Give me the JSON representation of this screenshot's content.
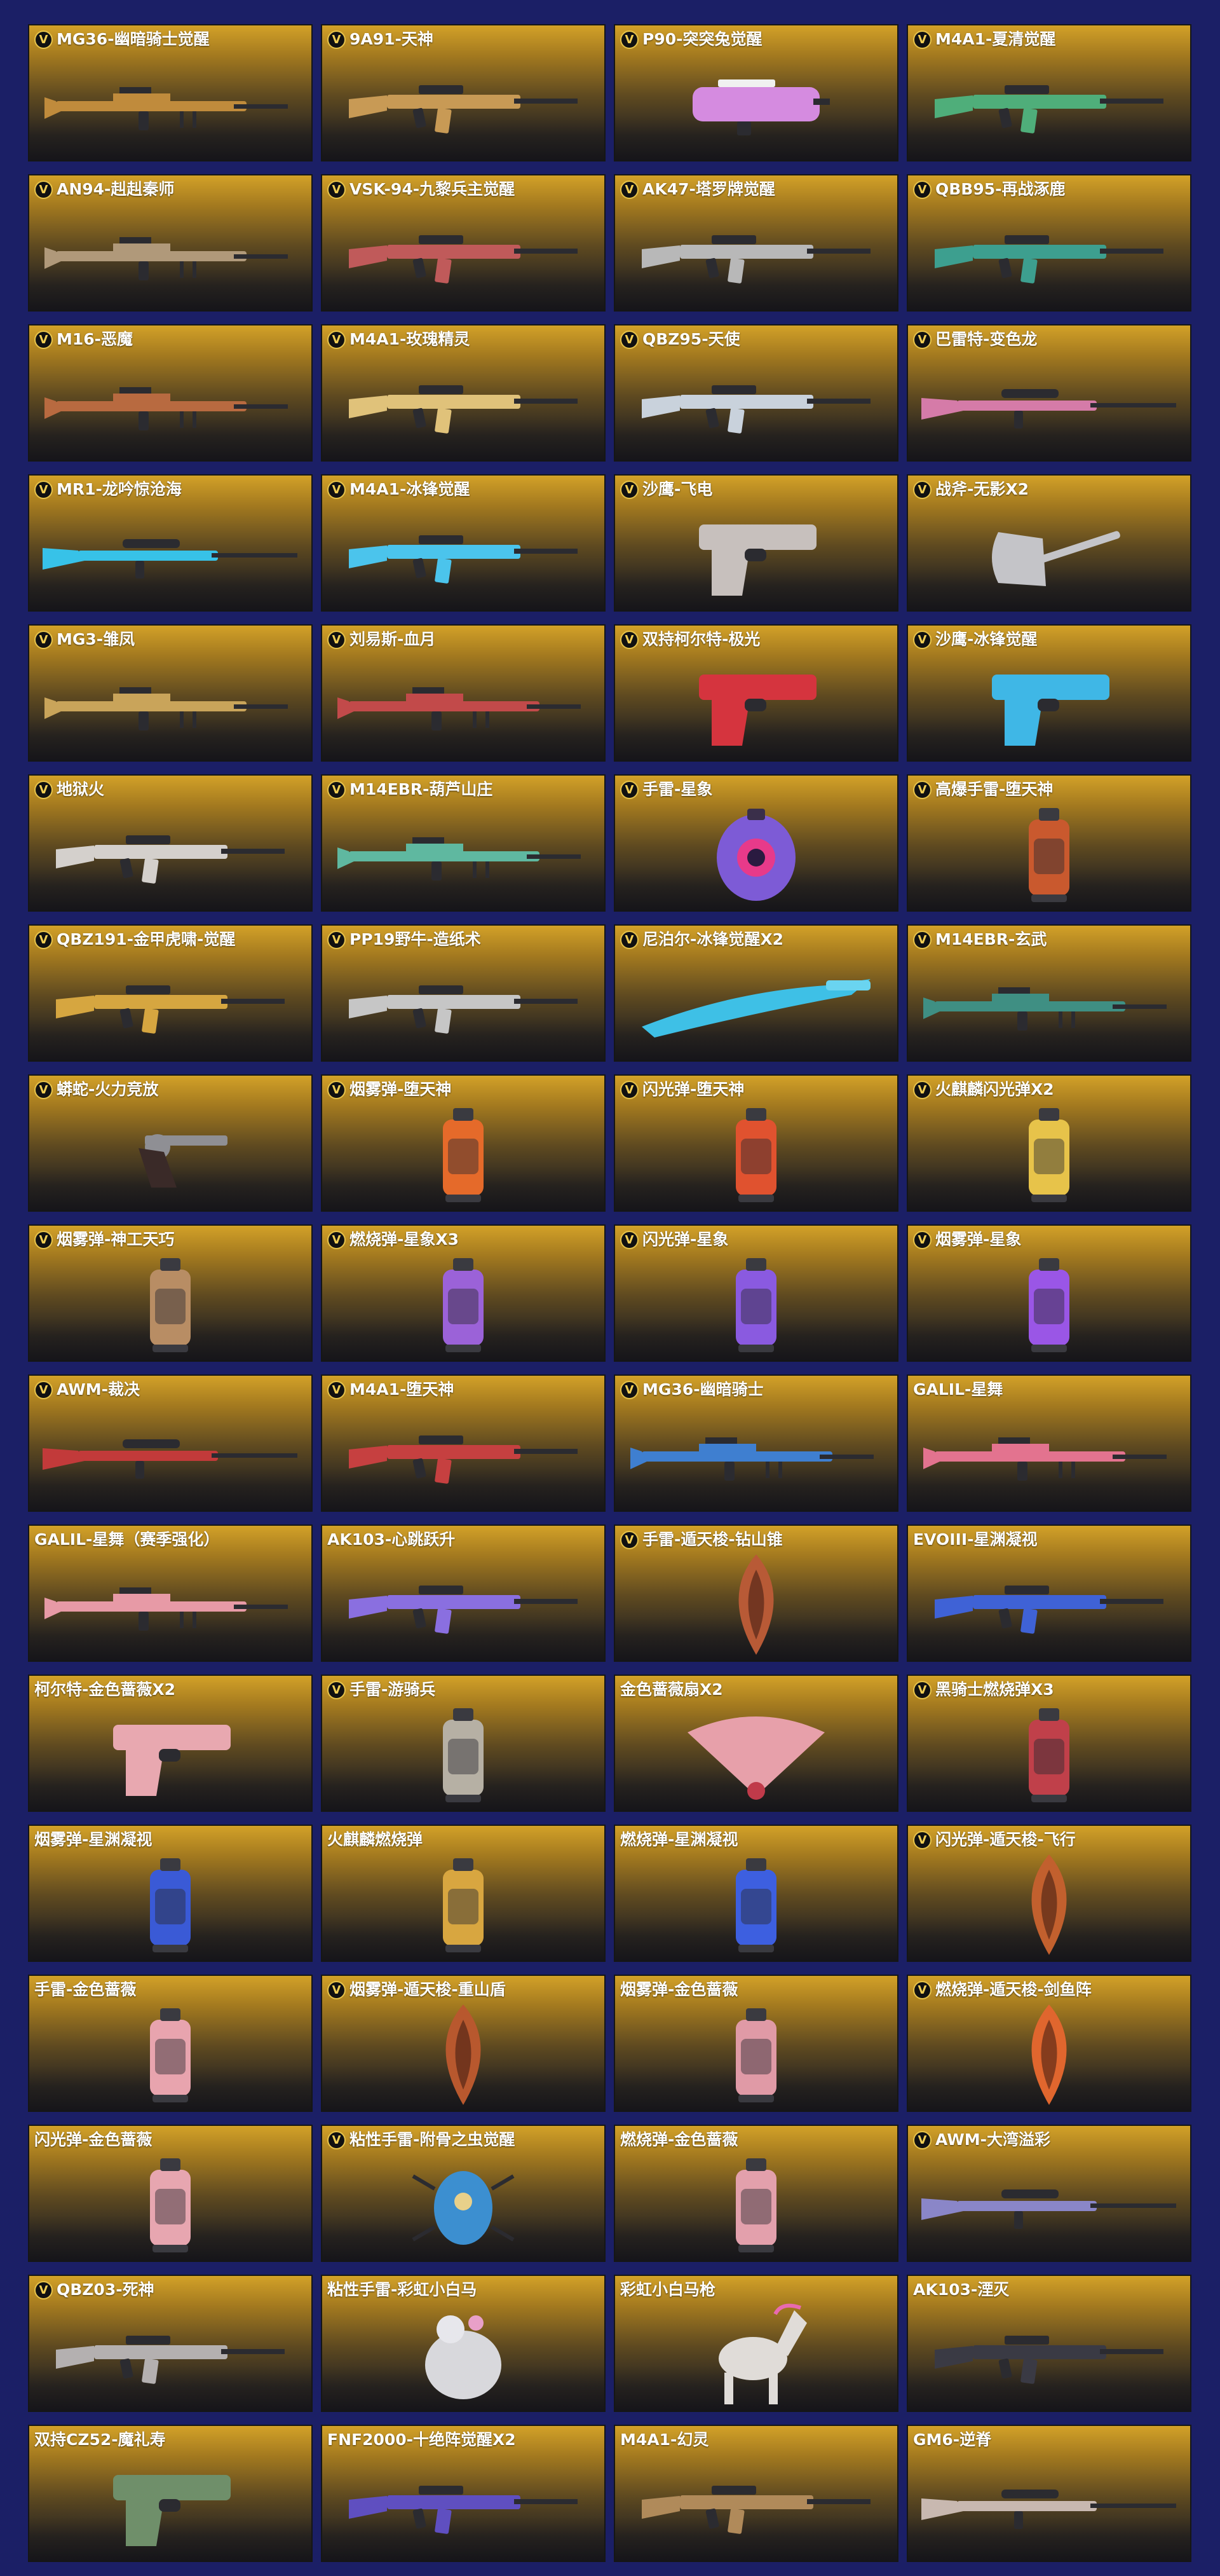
{
  "colors": {
    "page_background": "#1b1f66",
    "card_gold": "#d3a128",
    "card_dark": "#1d1c22",
    "title_text": "#ffffff",
    "v_badge": "#e7c34a"
  },
  "badge_text": "V",
  "items": [
    {
      "name": "MG36-幽暗骑士觉醒",
      "v": true,
      "icon": "long-gun-icon",
      "color": "#c08b3c"
    },
    {
      "name": "9A91-天神",
      "v": true,
      "icon": "rifle-icon",
      "color": "#c89a55"
    },
    {
      "name": "P90-突突兔觉醒",
      "v": true,
      "icon": "smg-icon",
      "color": "#d58be0"
    },
    {
      "name": "M4A1-夏清觉醒",
      "v": true,
      "icon": "rifle-icon",
      "color": "#4fae7a"
    },
    {
      "name": "AN94-赳赳秦师",
      "v": true,
      "icon": "long-gun-icon",
      "color": "#b0997a"
    },
    {
      "name": "VSK-94-九黎兵主觉醒",
      "v": true,
      "icon": "rifle-icon",
      "color": "#c05a5a"
    },
    {
      "name": "AK47-塔罗牌觉醒",
      "v": true,
      "icon": "rifle-icon",
      "color": "#b8b8b8"
    },
    {
      "name": "QBB95-再战涿鹿",
      "v": true,
      "icon": "rifle-icon",
      "color": "#3d9f8f"
    },
    {
      "name": "M16-恶魔",
      "v": true,
      "icon": "long-gun-icon",
      "color": "#b86a40"
    },
    {
      "name": "M4A1-玫瑰精灵",
      "v": true,
      "icon": "rifle-icon",
      "color": "#e0c27a"
    },
    {
      "name": "QBZ95-天使",
      "v": true,
      "icon": "rifle-icon",
      "color": "#c9d2dc"
    },
    {
      "name": "巴雷特-变色龙",
      "v": true,
      "icon": "sniper-icon",
      "color": "#d57ba8"
    },
    {
      "name": "MR1-龙吟惊沧海",
      "v": true,
      "icon": "sniper-icon",
      "color": "#37c2e8"
    },
    {
      "name": "M4A1-冰锋觉醒",
      "v": true,
      "icon": "rifle-icon",
      "color": "#4bc4ec"
    },
    {
      "name": "沙鹰-飞电",
      "v": true,
      "icon": "pistol-icon",
      "color": "#c7c0bd"
    },
    {
      "name": "战斧-无影X2",
      "v": true,
      "icon": "axe-icon",
      "color": "#c4c4c8"
    },
    {
      "name": "MG3-雏凤",
      "v": true,
      "icon": "long-gun-icon",
      "color": "#c9a45a"
    },
    {
      "name": "刘易斯-血月",
      "v": true,
      "icon": "long-gun-icon",
      "color": "#c24a4a"
    },
    {
      "name": "双持柯尔特-极光",
      "v": true,
      "icon": "pistol-icon",
      "color": "#d5343e"
    },
    {
      "name": "沙鹰-冰锋觉醒",
      "v": true,
      "icon": "pistol-icon",
      "color": "#3fb7e6"
    },
    {
      "name": "地狱火",
      "v": true,
      "icon": "rifle-icon",
      "color": "#d4d0cc"
    },
    {
      "name": "M14EBR-葫芦山庄",
      "v": true,
      "icon": "long-gun-icon",
      "color": "#5fb8a0"
    },
    {
      "name": "手雷-星象",
      "v": true,
      "icon": "grenade-icon",
      "color": "#7d5bd6"
    },
    {
      "name": "高爆手雷-堕天神",
      "v": true,
      "icon": "canister-icon",
      "color": "#c9592e"
    },
    {
      "name": "QBZ191-金甲虎啸-觉醒",
      "v": true,
      "icon": "rifle-icon",
      "color": "#d6a640"
    },
    {
      "name": "PP19野牛-造纸术",
      "v": true,
      "icon": "rifle-icon",
      "color": "#c6c6c6"
    },
    {
      "name": "尼泊尔-冰锋觉醒X2",
      "v": true,
      "icon": "blade-icon",
      "color": "#3ec0e6"
    },
    {
      "name": "M14EBR-玄武",
      "v": true,
      "icon": "long-gun-icon",
      "color": "#3f8f83"
    },
    {
      "name": "蟒蛇-火力竞放",
      "v": true,
      "icon": "revolver-icon",
      "color": "#8f8f94"
    },
    {
      "name": "烟雾弹-堕天神",
      "v": true,
      "icon": "canister-icon",
      "color": "#e56a2a"
    },
    {
      "name": "闪光弹-堕天神",
      "v": true,
      "icon": "canister-icon",
      "color": "#e0522f"
    },
    {
      "name": "火麒麟闪光弹X2",
      "v": true,
      "icon": "canister-icon",
      "color": "#e7c34a"
    },
    {
      "name": "烟雾弹-神工天巧",
      "v": true,
      "icon": "canister-icon",
      "color": "#b88d64"
    },
    {
      "name": "燃烧弹-星象X3",
      "v": true,
      "icon": "canister-icon",
      "color": "#9b62d8"
    },
    {
      "name": "闪光弹-星象",
      "v": true,
      "icon": "canister-icon",
      "color": "#8a5ae0"
    },
    {
      "name": "烟雾弹-星象",
      "v": true,
      "icon": "canister-icon",
      "color": "#9a56e6"
    },
    {
      "name": "AWM-裁决",
      "v": true,
      "icon": "sniper-icon",
      "color": "#c23a3a"
    },
    {
      "name": "M4A1-堕天神",
      "v": true,
      "icon": "rifle-icon",
      "color": "#c64040"
    },
    {
      "name": "MG36-幽暗骑士",
      "v": true,
      "icon": "long-gun-icon",
      "color": "#3f7fd0"
    },
    {
      "name": "GALIL-星舞",
      "v": false,
      "icon": "long-gun-icon",
      "color": "#e3738f"
    },
    {
      "name": "GALIL-星舞（赛季强化）",
      "v": false,
      "icon": "long-gun-icon",
      "color": "#e79aa6"
    },
    {
      "name": "AK103-心跳跃升",
      "v": false,
      "icon": "rifle-icon",
      "color": "#8a6fe0"
    },
    {
      "name": "手雷-遁天梭-钻山锥",
      "v": true,
      "icon": "leaf-icon",
      "color": "#b85a36"
    },
    {
      "name": "EVOIII-星渊凝视",
      "v": false,
      "icon": "rifle-icon",
      "color": "#3f62d6"
    },
    {
      "name": "柯尔特-金色蔷薇X2",
      "v": false,
      "icon": "pistol-icon",
      "color": "#e8a8b0"
    },
    {
      "name": "手雷-游骑兵",
      "v": true,
      "icon": "canister-icon",
      "color": "#b6b0a4"
    },
    {
      "name": "金色蔷薇扇X2",
      "v": false,
      "icon": "fan-icon",
      "color": "#e7a0aa"
    },
    {
      "name": "黑骑士燃烧弹X3",
      "v": true,
      "icon": "canister-icon",
      "color": "#c0404a"
    },
    {
      "name": "烟雾弹-星渊凝视",
      "v": false,
      "icon": "canister-icon",
      "color": "#3a5ad6"
    },
    {
      "name": "火麒麟燃烧弹",
      "v": false,
      "icon": "canister-icon",
      "color": "#d8a640"
    },
    {
      "name": "燃烧弹-星渊凝视",
      "v": false,
      "icon": "canister-icon",
      "color": "#3d5fe0"
    },
    {
      "name": "闪光弹-遁天梭-飞行",
      "v": true,
      "icon": "leaf-icon",
      "color": "#c2602e"
    },
    {
      "name": "手雷-金色蔷薇",
      "v": false,
      "icon": "canister-icon",
      "color": "#e8a4ae"
    },
    {
      "name": "烟雾弹-遁天梭-重山盾",
      "v": true,
      "icon": "leaf-icon",
      "color": "#b8582e"
    },
    {
      "name": "烟雾弹-金色蔷薇",
      "v": false,
      "icon": "canister-icon",
      "color": "#e09aa6"
    },
    {
      "name": "燃烧弹-遁天梭-剑鱼阵",
      "v": true,
      "icon": "leaf-icon",
      "color": "#e0662e"
    },
    {
      "name": "闪光弹-金色蔷薇",
      "v": false,
      "icon": "canister-icon",
      "color": "#e7a6b0"
    },
    {
      "name": "粘性手雷-附骨之虫觉醒",
      "v": true,
      "icon": "beetle-icon",
      "color": "#3c8fd0"
    },
    {
      "name": "燃烧弹-金色蔷薇",
      "v": false,
      "icon": "canister-icon",
      "color": "#e3a0ac"
    },
    {
      "name": "AWM-大湾溢彩",
      "v": true,
      "icon": "sniper-icon",
      "color": "#8a86c8"
    },
    {
      "name": "QBZ03-死神",
      "v": true,
      "icon": "rifle-icon",
      "color": "#b4b0b0"
    },
    {
      "name": "粘性手雷-彩虹小白马",
      "v": false,
      "icon": "blob-icon",
      "color": "#d8d8dc"
    },
    {
      "name": "彩虹小白马枪",
      "v": false,
      "icon": "horse-icon",
      "color": "#e0dcd8"
    },
    {
      "name": "AK103-湮灭",
      "v": false,
      "icon": "rifle-icon",
      "color": "#3a3a44"
    },
    {
      "name": "双持CZ52-魔礼寿",
      "v": false,
      "icon": "pistol-icon",
      "color": "#6f8f6a"
    },
    {
      "name": "FNF2000-十绝阵觉醒X2",
      "v": false,
      "icon": "rifle-icon",
      "color": "#5f4fc0"
    },
    {
      "name": "M4A1-幻灵",
      "v": false,
      "icon": "rifle-icon",
      "color": "#b08a5a"
    },
    {
      "name": "GM6-逆脊",
      "v": false,
      "icon": "sniper-icon",
      "color": "#c8b8b0"
    }
  ]
}
